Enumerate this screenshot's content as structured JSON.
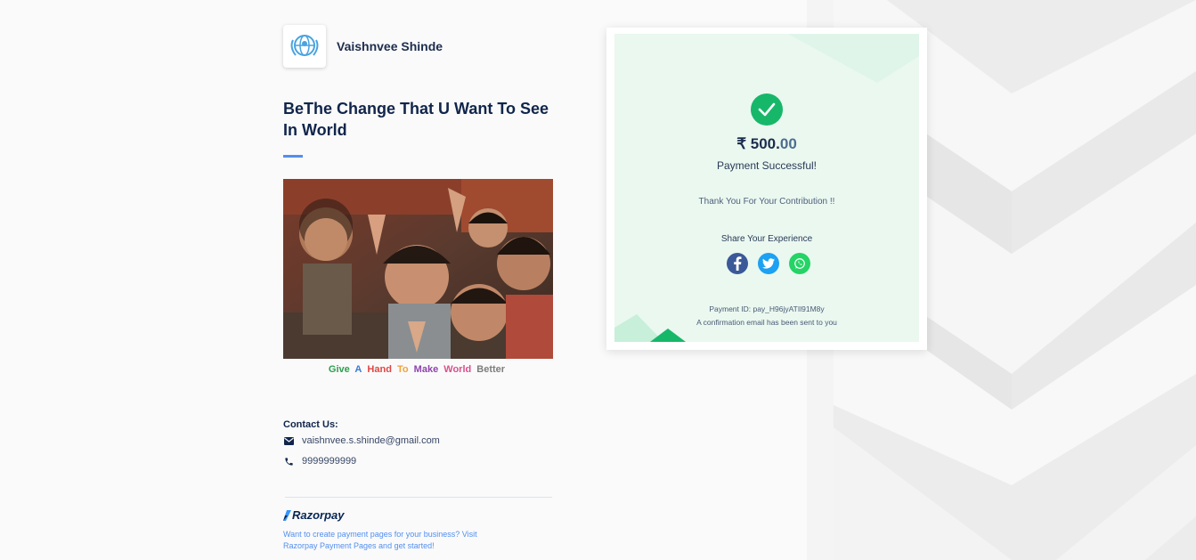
{
  "merchant": {
    "name": "Vaishnvee Shinde",
    "logo_icon": "unicef-globe-icon"
  },
  "page": {
    "headline": "BeThe Change That U Want To See In World",
    "caption_words": [
      {
        "text": "Give",
        "color": "#2e9e4f"
      },
      {
        "text": "A",
        "color": "#3a7bd5"
      },
      {
        "text": "Hand",
        "color": "#e04646"
      },
      {
        "text": "To",
        "color": "#f2a33a"
      },
      {
        "text": "Make",
        "color": "#8e44ad"
      },
      {
        "text": "World",
        "color": "#d9508c"
      },
      {
        "text": "Better",
        "color": "#7d7d7d"
      }
    ]
  },
  "contact": {
    "title": "Contact Us:",
    "email": "vaishnvee.s.shinde@gmail.com",
    "phone": "9999999999",
    "email_icon": "mail-icon",
    "phone_icon": "phone-icon"
  },
  "footer": {
    "brand": "Razorpay",
    "text": "Want to create payment pages for your business? Visit Razorpay Payment Pages and get started!"
  },
  "payment": {
    "currency_symbol": "₹",
    "amount_whole": "500.",
    "amount_decimal": "00",
    "status": "Payment Successful!",
    "thanks": "Thank You For Your Contribution !!",
    "share_label": "Share Your Experience",
    "payment_id": "Payment ID: pay_H96jyATIl91M8y",
    "confirmation": "A confirmation email has been sent to you",
    "success_color": "#17b76a"
  },
  "share": [
    {
      "name": "facebook-icon",
      "color": "#3b5998",
      "glyph": "f"
    },
    {
      "name": "twitter-icon",
      "color": "#1da1f2",
      "glyph": "t"
    },
    {
      "name": "whatsapp-icon",
      "color": "#25d366",
      "glyph": "w"
    }
  ],
  "colors": {
    "accent": "#528ff0",
    "brand_dark": "#10254b"
  }
}
